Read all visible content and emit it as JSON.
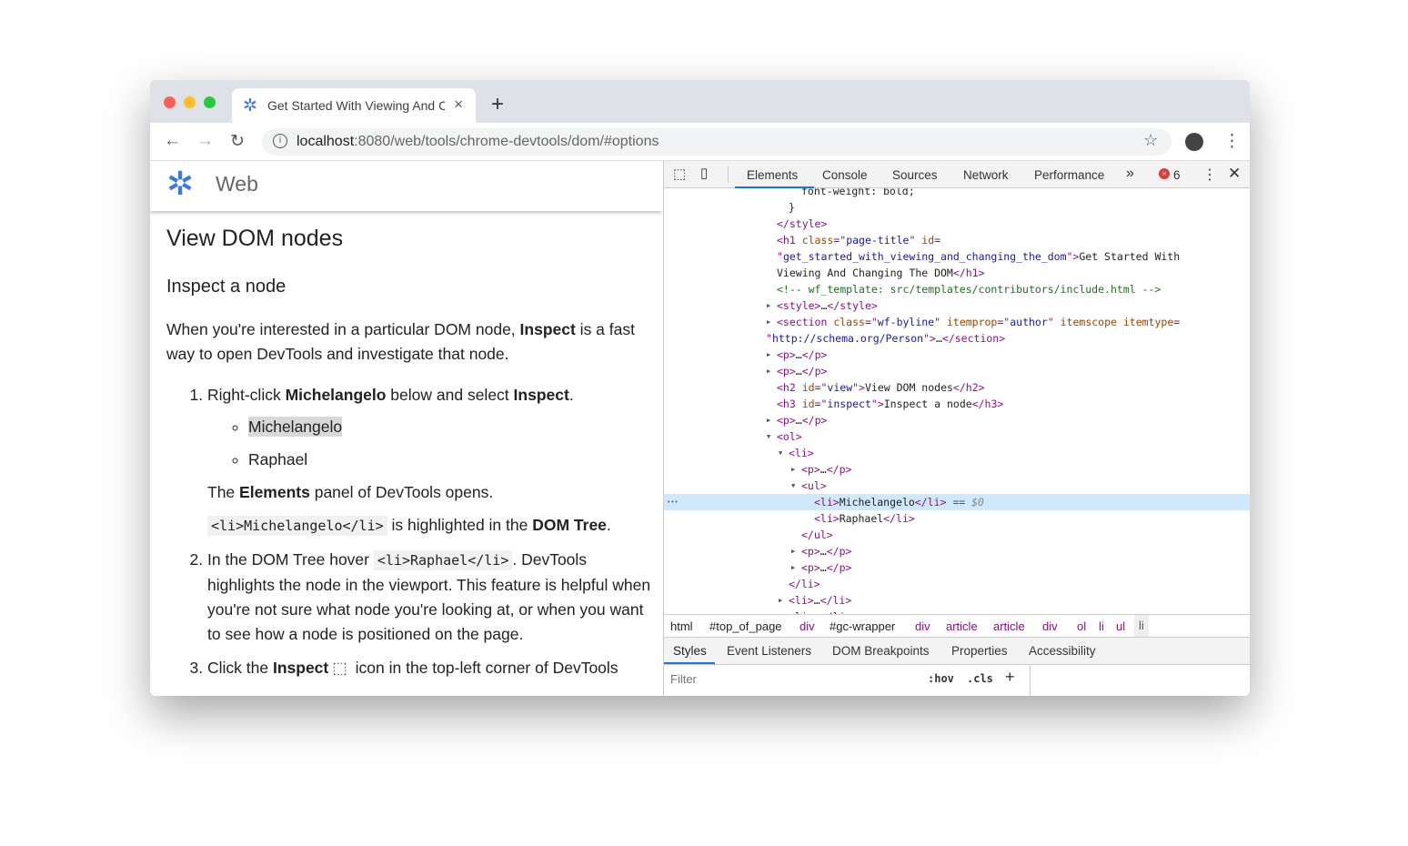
{
  "browser": {
    "tab_title": "Get Started With Viewing And Changing the DOM",
    "new_tab": "+",
    "close_tab": "×",
    "url_host": "localhost",
    "url_rest": ":8080/web/tools/chrome-devtools/dom/#options",
    "traffic_colors": [
      "#fe5f57",
      "#febc2e",
      "#28c840"
    ]
  },
  "page": {
    "site_name": "Web",
    "h2": "View DOM nodes",
    "h3": "Inspect a node",
    "intro": [
      [
        "t",
        "When you're interested in a particular DOM node, "
      ],
      [
        "b",
        "Inspect"
      ],
      [
        "t",
        " is a fast way to open DevTools and investigate that node."
      ]
    ],
    "steps": [
      {
        "p": [
          [
            "t",
            "Right-click "
          ],
          [
            "b",
            "Michelangelo"
          ],
          [
            "t",
            " below and select "
          ],
          [
            "b",
            "Inspect"
          ],
          [
            "t",
            "."
          ]
        ],
        "bullets": [
          "Michelangelo",
          "Raphael"
        ],
        "after": [
          [
            [
              "t",
              "The "
            ],
            [
              "b",
              "Elements"
            ],
            [
              "t",
              " panel of DevTools opens."
            ]
          ],
          [
            [
              "c",
              "<li>Michelangelo</li>"
            ],
            [
              "t",
              " is highlighted in the "
            ],
            [
              "b",
              "DOM Tree"
            ],
            [
              "t",
              "."
            ]
          ]
        ]
      },
      {
        "p": [
          [
            "t",
            "In the DOM Tree hover "
          ],
          [
            "c",
            "<li>Raphael</li>"
          ],
          [
            "t",
            ". DevTools highlights the node in the viewport. This feature is helpful when you're not sure what node you're looking at, or when you want to see how a node is positioned on the page."
          ]
        ]
      },
      {
        "p": [
          [
            "t",
            "Click the "
          ],
          [
            "b",
            "Inspect"
          ],
          [
            "i",
            ""
          ],
          [
            "t",
            " icon in the top-left corner of DevTools"
          ]
        ]
      }
    ]
  },
  "devtools": {
    "tabs": [
      "Elements",
      "Console",
      "Sources",
      "Network",
      "Performance"
    ],
    "more": "»",
    "error_count": "6",
    "tree": [
      {
        "lv": 2,
        "s": [
          [
            "txt",
            "font-weight: bold;"
          ]
        ]
      },
      {
        "lv": 1,
        "s": [
          [
            "txt",
            "}"
          ]
        ]
      },
      {
        "lv": 0,
        "s": [
          [
            "tag",
            "</style>"
          ]
        ]
      },
      {
        "lv": 0,
        "s": [
          [
            "tag",
            "<h1 "
          ],
          [
            "attr",
            "class"
          ],
          [
            "tag",
            "=\""
          ],
          [
            "val",
            "page-title"
          ],
          [
            "tag",
            "\" "
          ],
          [
            "attr",
            "id"
          ],
          [
            "tag",
            "="
          ]
        ]
      },
      {
        "lv": 0,
        "s": [
          [
            "tag",
            "\""
          ],
          [
            "val",
            "get_started_with_viewing_and_changing_the_dom"
          ],
          [
            "tag",
            "\">"
          ],
          [
            "txt",
            "Get Started With"
          ]
        ]
      },
      {
        "lv": 0,
        "s": [
          [
            "txt",
            "Viewing And Changing The DOM"
          ],
          [
            "tag",
            "</h1>"
          ]
        ]
      },
      {
        "lv": 0,
        "s": [
          [
            "com",
            "<!-- wf_template: src/templates/contributors/include.html -->"
          ]
        ]
      },
      {
        "lv": 0,
        "arrow": "right",
        "s": [
          [
            "tag",
            "<style>"
          ],
          [
            "txt",
            "…"
          ],
          [
            "tag",
            "</style>"
          ]
        ]
      },
      {
        "lv": 0,
        "arrow": "right",
        "s": [
          [
            "tag",
            "<section "
          ],
          [
            "attr",
            "class"
          ],
          [
            "tag",
            "=\""
          ],
          [
            "val",
            "wf-byline"
          ],
          [
            "tag",
            "\" "
          ],
          [
            "attr",
            "itemprop"
          ],
          [
            "tag",
            "=\""
          ],
          [
            "val",
            "author"
          ],
          [
            "tag",
            "\" "
          ],
          [
            "attr",
            "itemscope itemtype"
          ],
          [
            "tag",
            "="
          ]
        ]
      },
      {
        "lv": -1,
        "s": [
          [
            "tag",
            "\""
          ],
          [
            "val",
            "http://schema.org/Person"
          ],
          [
            "tag",
            "\">"
          ],
          [
            "txt",
            "…"
          ],
          [
            "tag",
            "</section>"
          ]
        ]
      },
      {
        "lv": 0,
        "arrow": "right",
        "s": [
          [
            "tag",
            "<p>"
          ],
          [
            "txt",
            "…"
          ],
          [
            "tag",
            "</p>"
          ]
        ]
      },
      {
        "lv": 0,
        "arrow": "right",
        "s": [
          [
            "tag",
            "<p>"
          ],
          [
            "txt",
            "…"
          ],
          [
            "tag",
            "</p>"
          ]
        ]
      },
      {
        "lv": 0,
        "s": [
          [
            "tag",
            "<h2 "
          ],
          [
            "attr",
            "id"
          ],
          [
            "tag",
            "=\""
          ],
          [
            "val",
            "view"
          ],
          [
            "tag",
            "\">"
          ],
          [
            "txt",
            "View DOM nodes"
          ],
          [
            "tag",
            "</h2>"
          ]
        ]
      },
      {
        "lv": 0,
        "s": [
          [
            "tag",
            "<h3 "
          ],
          [
            "attr",
            "id"
          ],
          [
            "tag",
            "=\""
          ],
          [
            "val",
            "inspect"
          ],
          [
            "tag",
            "\">"
          ],
          [
            "txt",
            "Inspect a node"
          ],
          [
            "tag",
            "</h3>"
          ]
        ]
      },
      {
        "lv": 0,
        "arrow": "right",
        "s": [
          [
            "tag",
            "<p>"
          ],
          [
            "txt",
            "…"
          ],
          [
            "tag",
            "</p>"
          ]
        ]
      },
      {
        "lv": 0,
        "arrow": "down",
        "s": [
          [
            "tag",
            "<ol>"
          ]
        ]
      },
      {
        "lv": 1,
        "arrow": "down",
        "s": [
          [
            "tag",
            "<li>"
          ]
        ]
      },
      {
        "lv": 2,
        "arrow": "right",
        "s": [
          [
            "tag",
            "<p>"
          ],
          [
            "txt",
            "…"
          ],
          [
            "tag",
            "</p>"
          ]
        ]
      },
      {
        "lv": 2,
        "arrow": "down",
        "s": [
          [
            "tag",
            "<ul>"
          ]
        ]
      },
      {
        "lv": 3,
        "selected": true,
        "s": [
          [
            "tag",
            "<li>"
          ],
          [
            "txt",
            "Michelangelo"
          ],
          [
            "tag",
            "</li>"
          ],
          [
            "eq",
            " == "
          ],
          [
            "dollar",
            "$0"
          ]
        ]
      },
      {
        "lv": 3,
        "s": [
          [
            "tag",
            "<li>"
          ],
          [
            "txt",
            "Raphael"
          ],
          [
            "tag",
            "</li>"
          ]
        ]
      },
      {
        "lv": 2,
        "s": [
          [
            "tag",
            "</ul>"
          ]
        ]
      },
      {
        "lv": 2,
        "arrow": "right",
        "s": [
          [
            "tag",
            "<p>"
          ],
          [
            "txt",
            "…"
          ],
          [
            "tag",
            "</p>"
          ]
        ]
      },
      {
        "lv": 2,
        "arrow": "right",
        "s": [
          [
            "tag",
            "<p>"
          ],
          [
            "txt",
            "…"
          ],
          [
            "tag",
            "</p>"
          ]
        ]
      },
      {
        "lv": 1,
        "s": [
          [
            "tag",
            "</li>"
          ]
        ]
      },
      {
        "lv": 1,
        "arrow": "right",
        "s": [
          [
            "tag",
            "<li>"
          ],
          [
            "txt",
            "…"
          ],
          [
            "tag",
            "</li>"
          ]
        ]
      },
      {
        "lv": 1,
        "arrow": "right",
        "s": [
          [
            "tag",
            "<li>"
          ],
          [
            "txt",
            "…"
          ],
          [
            "tag",
            "</li>"
          ]
        ]
      }
    ],
    "selected_dots": "•••",
    "breadcrumbs": [
      "html",
      "#top_of_page",
      "div",
      "#gc-wrapper",
      "div",
      "article",
      "article",
      "div",
      "ol",
      "li",
      "ul",
      "li"
    ],
    "subtabs": [
      "Styles",
      "Event Listeners",
      "DOM Breakpoints",
      "Properties",
      "Accessibility"
    ],
    "filter_placeholder": "Filter",
    "hov": ":hov",
    "cls": ".cls",
    "add": "+"
  }
}
